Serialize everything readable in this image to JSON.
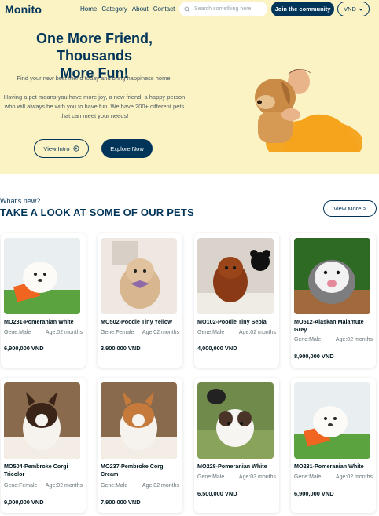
{
  "header": {
    "logo": "Monito",
    "nav": [
      "Home",
      "Category",
      "About",
      "Contact"
    ],
    "search_placeholder": "Search something here",
    "join_label": "Join the community",
    "currency": "VND"
  },
  "hero": {
    "title_line1": "One More Friend, Thousands",
    "title_line2": "More Fun!",
    "subtitle": "Find your new best friend today and bring happiness home.",
    "description": "Having a pet means you have more joy, a new friend, a happy person who will always be with you to have fun. We have 200+ different pets that can meet your needs!",
    "intro_button": "View Intro",
    "explore_button": "Explore Now"
  },
  "pets_section": {
    "eyebrow": "What's new?",
    "title": "TAKE A LOOK AT SOME OF OUR PETS",
    "view_more": "View More >"
  },
  "pets": [
    {
      "name": "MO231-Pomeranian White",
      "gene": "Gene:Male",
      "age": "Age:02 months",
      "price": "6,900,000 VND",
      "image": "pomeranian-white-photo"
    },
    {
      "name": "MO502-Poodle Tiny Yellow",
      "gene": "Gene:Female",
      "age": "Age:02 months",
      "price": "3,900,000 VND",
      "image": "poodle-yellow-photo"
    },
    {
      "name": "MO102-Poodle Tiny Sepia",
      "gene": "Gene:Male",
      "age": "Age:02 months",
      "price": "4,000,000 VND",
      "image": "poodle-sepia-photo"
    },
    {
      "name": "MO512-Alaskan Malamute Grey",
      "gene": "Gene:Male",
      "age": "Age:02 months",
      "price": "8,900,000 VND",
      "image": "malamute-grey-photo"
    },
    {
      "name": "MO504-Pembroke Corgi Tricolor",
      "gene": "Gene:Female",
      "age": "Age:02 months",
      "price": "9,000,000 VND",
      "image": "corgi-tricolor-photo"
    },
    {
      "name": "MO237-Pembroke Corgi Cream",
      "gene": "Gene:Male",
      "age": "Age:02 months",
      "price": "7,900,000 VND",
      "image": "corgi-cream-photo"
    },
    {
      "name": "MO228-Pomeranian White",
      "gene": "Gene:Male",
      "age": "Age:03 months",
      "price": "6,500,000 VND",
      "image": "pomeranian-white-photo"
    },
    {
      "name": "MO231-Pomeranian White",
      "gene": "Gene:Male",
      "age": "Age:02 months",
      "price": "6,900,000 VND",
      "image": "pomeranian-white-photo"
    }
  ],
  "colors": {
    "brand": "#003459",
    "hero_bg": "#fcf3c4",
    "text": "#00171f",
    "muted": "#667479"
  }
}
